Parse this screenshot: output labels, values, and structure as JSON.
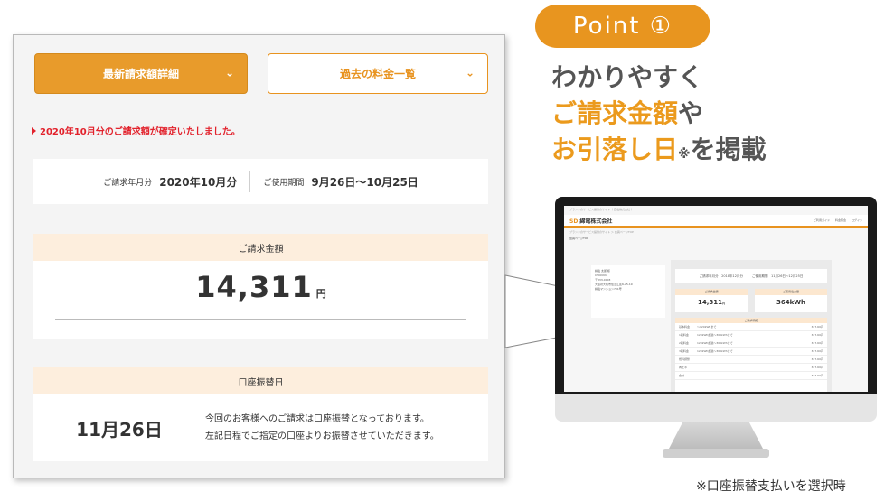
{
  "panel": {
    "tabs": [
      {
        "label": "最新請求額詳細",
        "active": true
      },
      {
        "label": "過去の料金一覧",
        "active": false
      }
    ],
    "notice": "2020年10月分のご請求額が確定いたしました。",
    "period": {
      "bill_month_label": "ご請求年月分",
      "bill_month_value": "2020年10月分",
      "usage_label": "ご使用期間",
      "usage_value": "9月26日〜10月25日"
    },
    "amount": {
      "header": "ご請求金額",
      "value": "14,311",
      "unit": "円"
    },
    "debit": {
      "header": "口座振替日",
      "date": "11月26日",
      "line1": "今回のお客様へのご請求は口座振替となっております。",
      "line2": "左記日程でご指定の口座よりお振替させていただきます。"
    }
  },
  "badge": {
    "text": "Point ①"
  },
  "headline": {
    "line1": "わかりやすく",
    "line2": "ご請求金額",
    "line2_suffix": "や",
    "line3": "お引落し日",
    "line3_mark": "※",
    "line3_suffix": "を掲載"
  },
  "footnote": "※口座振替支払いを選択時",
  "monitor": {
    "topline": "ブランドのサービス提供のサイト（ 西電株式会社 ）",
    "logo_mark": "SD",
    "logo_text": "綿電株式会社",
    "nav": [
      "ご利用ガイド",
      "料金照会",
      "ログイン"
    ],
    "crumb": "ブランドのサービス提供のサイト ＞ 会員ページTOP",
    "page_title": "会員ページTOP",
    "side": [
      "綿電 太郎 様",
      "CS0XXXX",
      "〒333-0003",
      "大阪府大阪市住之江区6-25-19",
      "綿電マンション701号"
    ],
    "period_a": "ご請求年月分　2018年12月分",
    "period_b": "ご使用期間　11月26日〜12月25日",
    "card1_head": "ご請求金額",
    "card1_val": "14,311",
    "card1_unit": "円",
    "card2_head": "ご使用電力量",
    "card2_val": "364kWh",
    "table_head": "ご請求明細",
    "rows": [
      {
        "a": "基本料金",
        "b": "〜120kWhまで",
        "c": "327.60円"
      },
      {
        "a": "1段料金",
        "b": "120kWh超過〜300kWhまで",
        "c": "327.60円"
      },
      {
        "a": "2段料金",
        "b": "120kWh超過〜300kWhまで",
        "c": "327.60円"
      },
      {
        "a": "3段料金",
        "b": "120kWh超過〜300kWhまで",
        "c": "327.60円"
      },
      {
        "a": "燃料調整",
        "b": "",
        "c": "327.60円"
      },
      {
        "a": "再エネ",
        "b": "",
        "c": "327.60円"
      },
      {
        "a": "合計",
        "b": "",
        "c": "327.60円"
      }
    ]
  },
  "colors": {
    "accent": "#e8951f",
    "notice": "#e2222c",
    "header_bg": "#fdeedd"
  }
}
